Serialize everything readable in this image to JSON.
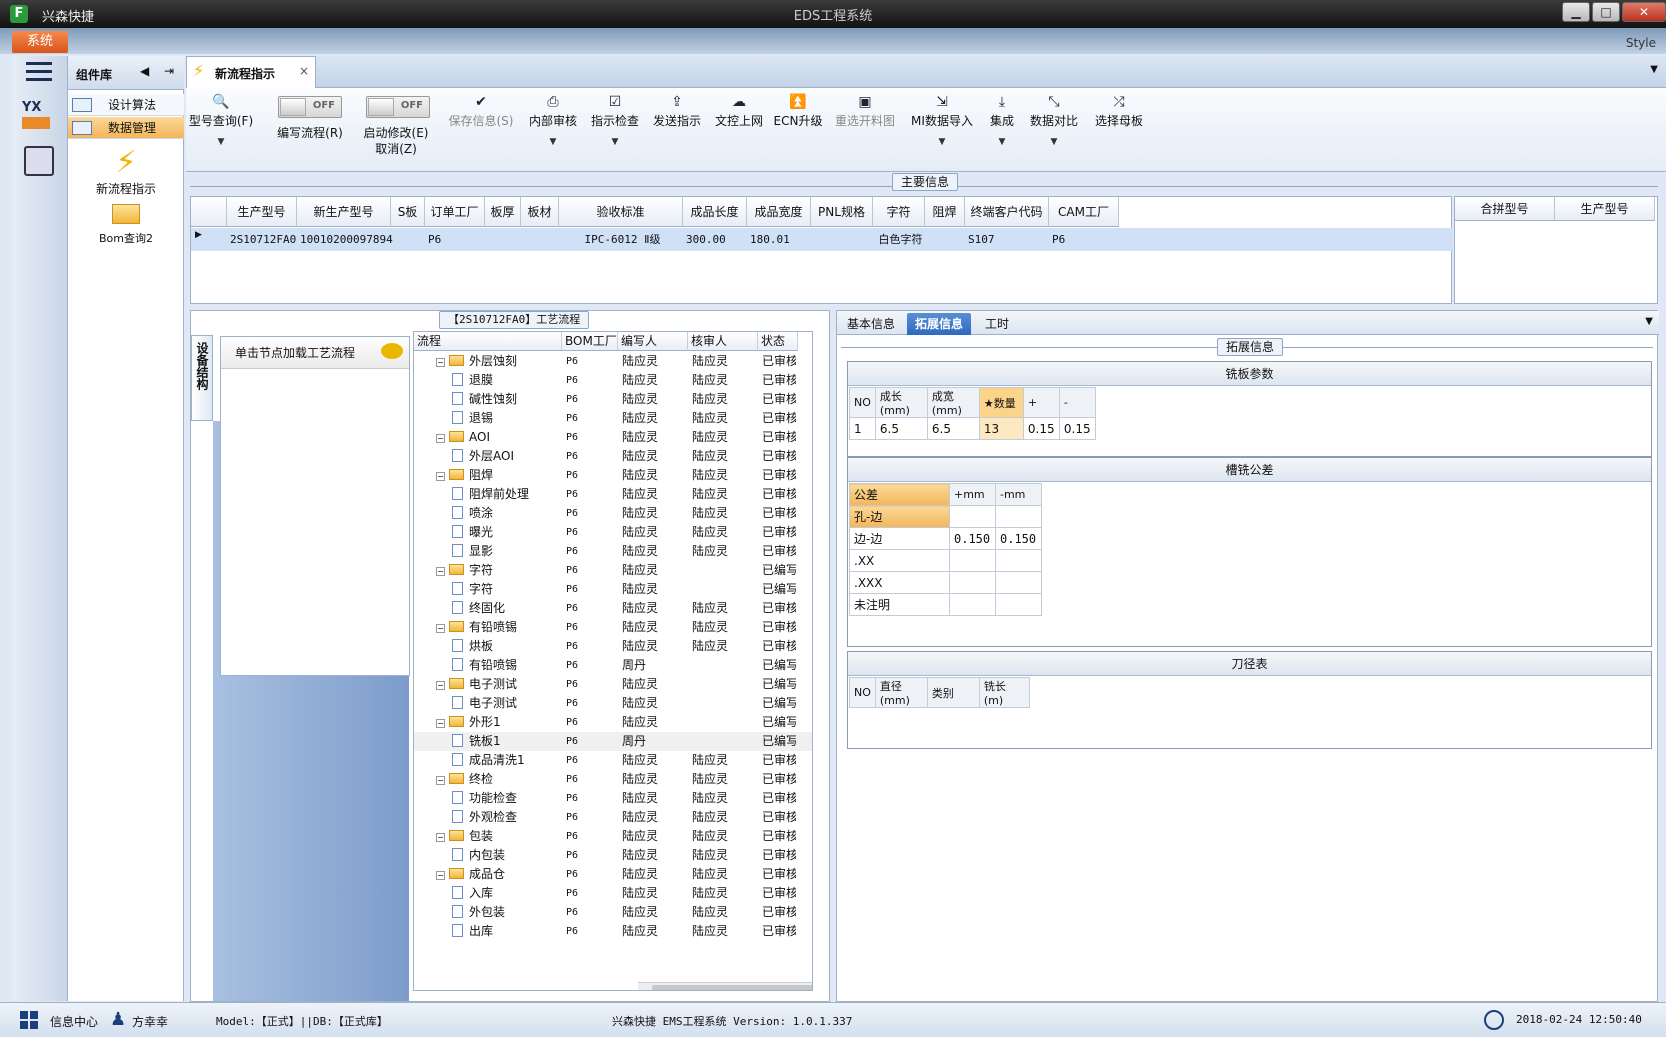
{
  "window": {
    "app_name": "兴森快捷",
    "title": "EDS工程系统",
    "style_label": "Style",
    "min": "▁",
    "max": "□",
    "close": "✕"
  },
  "menu": {
    "system": "系统"
  },
  "library": {
    "title": "组件库",
    "items": [
      {
        "label": "设计算法"
      },
      {
        "label": "数据管理"
      }
    ],
    "tools": [
      {
        "label": "新流程指示"
      },
      {
        "label": "Bom查询2"
      }
    ]
  },
  "tabs": {
    "active": "新流程指示",
    "close": "×"
  },
  "toolbar": {
    "type_query": "型号查询(F)",
    "edit_flow": "编写流程(R)",
    "enable_modify": "启动修改(E)",
    "cancel": "取消(Z)",
    "save_info": "保存信息(S)",
    "internal_review": "内部审核",
    "indicate_check": "指示检查",
    "send_indicate": "发送指示",
    "doc_upload": "文控上网",
    "ecn_upgrade": "ECN升级",
    "reselect_cut": "重选开料图",
    "mi_import": "MI数据导入",
    "integrate": "集成",
    "data_compare": "数据对比",
    "select_mother": "选择母板",
    "toggle_off": "OFF"
  },
  "main_info": {
    "title": "主要信息",
    "columns": [
      "生产型号",
      "新生产型号",
      "S板",
      "订单工厂",
      "板厚",
      "板材",
      "验收标准",
      "成品长度",
      "成品宽度",
      "PNL规格",
      "字符",
      "阻焊",
      "终端客户代码",
      "CAM工厂"
    ],
    "row": [
      "2S10712FA0",
      "10010200097894",
      "",
      "P6",
      "",
      "",
      "IPC-6012 Ⅱ级",
      "300.00",
      "180.01",
      "",
      "白色字符",
      "",
      "S107",
      "P6"
    ],
    "merge_columns": [
      "合拼型号",
      "生产型号"
    ]
  },
  "process": {
    "title": "【2S10712FA0】工艺流程",
    "side_tab": "设备结构",
    "hint": "单击节点加载工艺流程",
    "columns": [
      "流程",
      "BOM工厂",
      "编写人",
      "核审人",
      "状态"
    ],
    "rows": [
      {
        "name": "外层蚀刻",
        "level": 0,
        "factory": "P6",
        "writer": "陆应灵",
        "reviewer": "陆应灵",
        "status": "已审核"
      },
      {
        "name": "退膜",
        "level": 1,
        "factory": "P6",
        "writer": "陆应灵",
        "reviewer": "陆应灵",
        "status": "已审核"
      },
      {
        "name": "碱性蚀刻",
        "level": 1,
        "factory": "P6",
        "writer": "陆应灵",
        "reviewer": "陆应灵",
        "status": "已审核"
      },
      {
        "name": "退锡",
        "level": 1,
        "factory": "P6",
        "writer": "陆应灵",
        "reviewer": "陆应灵",
        "status": "已审核"
      },
      {
        "name": "AOI",
        "level": 0,
        "factory": "P6",
        "writer": "陆应灵",
        "reviewer": "陆应灵",
        "status": "已审核"
      },
      {
        "name": "外层AOI",
        "level": 1,
        "factory": "P6",
        "writer": "陆应灵",
        "reviewer": "陆应灵",
        "status": "已审核"
      },
      {
        "name": "阻焊",
        "level": 0,
        "factory": "P6",
        "writer": "陆应灵",
        "reviewer": "陆应灵",
        "status": "已审核"
      },
      {
        "name": "阻焊前处理",
        "level": 1,
        "factory": "P6",
        "writer": "陆应灵",
        "reviewer": "陆应灵",
        "status": "已审核"
      },
      {
        "name": "喷涂",
        "level": 1,
        "factory": "P6",
        "writer": "陆应灵",
        "reviewer": "陆应灵",
        "status": "已审核"
      },
      {
        "name": "曝光",
        "level": 1,
        "factory": "P6",
        "writer": "陆应灵",
        "reviewer": "陆应灵",
        "status": "已审核"
      },
      {
        "name": "显影",
        "level": 1,
        "factory": "P6",
        "writer": "陆应灵",
        "reviewer": "陆应灵",
        "status": "已审核"
      },
      {
        "name": "字符",
        "level": 0,
        "factory": "P6",
        "writer": "陆应灵",
        "reviewer": "",
        "status": "已编写"
      },
      {
        "name": "字符",
        "level": 1,
        "factory": "P6",
        "writer": "陆应灵",
        "reviewer": "",
        "status": "已编写"
      },
      {
        "name": "终固化",
        "level": 1,
        "factory": "P6",
        "writer": "陆应灵",
        "reviewer": "陆应灵",
        "status": "已审核"
      },
      {
        "name": "有铅喷锡",
        "level": 0,
        "factory": "P6",
        "writer": "陆应灵",
        "reviewer": "陆应灵",
        "status": "已审核"
      },
      {
        "name": "烘板",
        "level": 1,
        "factory": "P6",
        "writer": "陆应灵",
        "reviewer": "陆应灵",
        "status": "已审核"
      },
      {
        "name": "有铅喷锡",
        "level": 1,
        "factory": "P6",
        "writer": "周丹",
        "reviewer": "",
        "status": "已编写"
      },
      {
        "name": "电子测试",
        "level": 0,
        "factory": "P6",
        "writer": "陆应灵",
        "reviewer": "",
        "status": "已编写"
      },
      {
        "name": "电子测试",
        "level": 1,
        "factory": "P6",
        "writer": "陆应灵",
        "reviewer": "",
        "status": "已编写"
      },
      {
        "name": "外形1",
        "level": 0,
        "factory": "P6",
        "writer": "陆应灵",
        "reviewer": "",
        "status": "已编写"
      },
      {
        "name": "铣板1",
        "level": 1,
        "factory": "P6",
        "writer": "周丹",
        "reviewer": "",
        "status": "已编写"
      },
      {
        "name": "成品清洗1",
        "level": 1,
        "factory": "P6",
        "writer": "陆应灵",
        "reviewer": "陆应灵",
        "status": "已审核"
      },
      {
        "name": "终检",
        "level": 0,
        "factory": "P6",
        "writer": "陆应灵",
        "reviewer": "陆应灵",
        "status": "已审核"
      },
      {
        "name": "功能检查",
        "level": 1,
        "factory": "P6",
        "writer": "陆应灵",
        "reviewer": "陆应灵",
        "status": "已审核"
      },
      {
        "name": "外观检查",
        "level": 1,
        "factory": "P6",
        "writer": "陆应灵",
        "reviewer": "陆应灵",
        "status": "已审核"
      },
      {
        "name": "包装",
        "level": 0,
        "factory": "P6",
        "writer": "陆应灵",
        "reviewer": "陆应灵",
        "status": "已审核"
      },
      {
        "name": "内包装",
        "level": 1,
        "factory": "P6",
        "writer": "陆应灵",
        "reviewer": "陆应灵",
        "status": "已审核"
      },
      {
        "name": "成品仓",
        "level": 0,
        "factory": "P6",
        "writer": "陆应灵",
        "reviewer": "陆应灵",
        "status": "已审核"
      },
      {
        "name": "入库",
        "level": 1,
        "factory": "P6",
        "writer": "陆应灵",
        "reviewer": "陆应灵",
        "status": "已审核"
      },
      {
        "name": "外包装",
        "level": 1,
        "factory": "P6",
        "writer": "陆应灵",
        "reviewer": "陆应灵",
        "status": "已审核"
      },
      {
        "name": "出库",
        "level": 1,
        "factory": "P6",
        "writer": "陆应灵",
        "reviewer": "陆应灵",
        "status": "已审核"
      }
    ]
  },
  "right": {
    "tabs": [
      "基本信息",
      "拓展信息",
      "工时"
    ],
    "group_title": "拓展信息",
    "mill_params": {
      "title": "铣板参数",
      "headers": [
        "NO",
        "成长(mm)",
        "成宽(mm)",
        "★数量",
        "+",
        "-"
      ],
      "row": [
        "1",
        "6.5",
        "6.5",
        "13",
        "0.15",
        "0.15"
      ]
    },
    "slot_tolerance": {
      "title": "槽铣公差",
      "headers": [
        "公差",
        "+mm",
        "-mm"
      ],
      "rows": [
        [
          "孔-边",
          "",
          ""
        ],
        [
          "边-边",
          "0.150",
          "0.150"
        ],
        [
          ".XX",
          "",
          ""
        ],
        [
          ".XXX",
          "",
          ""
        ],
        [
          "未注明",
          "",
          ""
        ]
      ]
    },
    "tool_table": {
      "title": "刀径表",
      "headers": [
        "NO",
        "直径(mm)",
        "类别",
        "铣长(m)"
      ]
    }
  },
  "status": {
    "info_center": "信息中心",
    "user": "方幸幸",
    "model": "Model:【正式】||DB:【正式库】",
    "version": "兴森快捷 EMS工程系统 Version: 1.0.1.337",
    "datetime": "2018-02-24 12:50:40"
  },
  "colors": {
    "accent": "#2e69c0",
    "selected": "#f3b55a",
    "system_button": "#e06a2e"
  }
}
